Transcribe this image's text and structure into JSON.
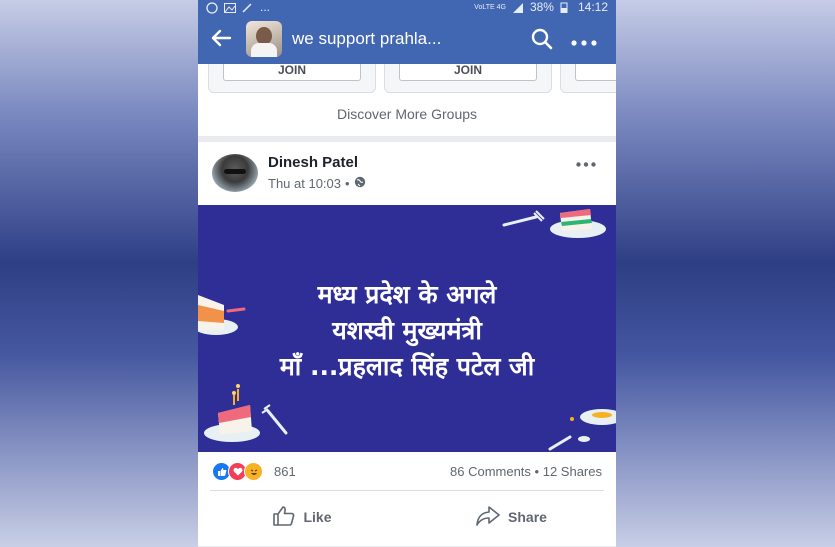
{
  "status_bar": {
    "left_text": "...",
    "network": "VoLTE 4G",
    "battery": "38%",
    "time": "14:12"
  },
  "app_bar": {
    "title": "we support prahla...",
    "icons": [
      "back-arrow-icon",
      "search-icon",
      "more-icon"
    ]
  },
  "groups_strip": {
    "join_label_1": "JOIN",
    "join_label_2": "JOIN",
    "discover_label": "Discover More Groups"
  },
  "post": {
    "author": "Dinesh Patel",
    "time": "Thu at 10:03",
    "separator": "•",
    "privacy_icon": "globe-icon",
    "banner": {
      "line1": "मध्य प्रदेश के अगले",
      "line2": "यशस्वी  मुख्यमंत्री",
      "line3": "माँ ...प्रहलाद सिंह पटेल जी",
      "background_color": "#2f2d96"
    },
    "reaction_count": "861",
    "comments": "86 Comments",
    "shares": "12 Shares",
    "like_label": "Like",
    "share_label": "Share"
  },
  "colors": {
    "facebook_blue": "#4267b2",
    "banner_blue": "#2f2d96"
  }
}
